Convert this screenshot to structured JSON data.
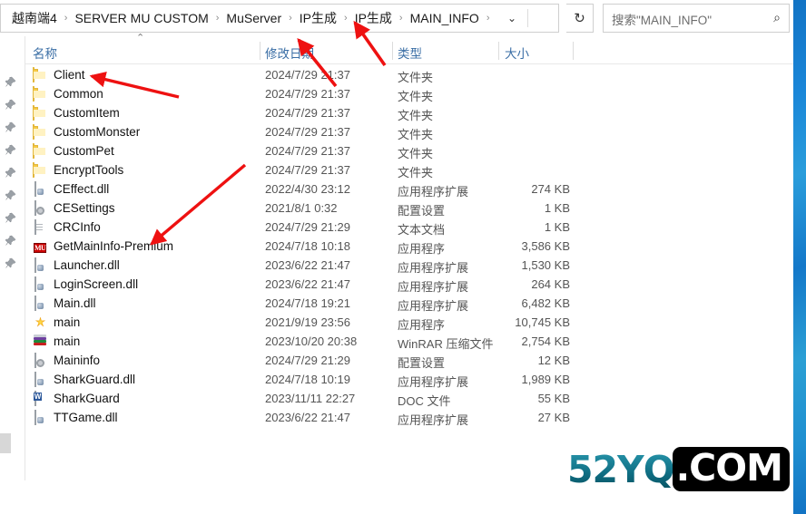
{
  "window": {
    "kind": "windows-file-explorer",
    "accent_blue": "#3a6ea5",
    "folder_yellow": "#ffd966",
    "annotation_red": "#ee1111"
  },
  "addressbar": {
    "crumbs": [
      {
        "label": "越南端4"
      },
      {
        "label": "SERVER MU CUSTOM"
      },
      {
        "label": "MuServer"
      },
      {
        "label": "IP生成"
      },
      {
        "label": "IP生成"
      },
      {
        "label": "MAIN_INFO"
      }
    ],
    "separator": "›",
    "history_dropdown_icon": "⌄",
    "refresh_icon": "↻"
  },
  "search": {
    "placeholder": "搜索\"MAIN_INFO\"",
    "icon": "⌕"
  },
  "columns": {
    "name": "名称",
    "date_modified": "修改日期",
    "type": "类型",
    "size": "大小",
    "sort_caret": "⌃",
    "sorted_by": "名称",
    "sort_direction": "ascending"
  },
  "rows": [
    {
      "icon": "folder",
      "name": "Client",
      "date": "2024/7/29 21:37",
      "type": "文件夹",
      "size": ""
    },
    {
      "icon": "folder",
      "name": "Common",
      "date": "2024/7/29 21:37",
      "type": "文件夹",
      "size": ""
    },
    {
      "icon": "folder",
      "name": "CustomItem",
      "date": "2024/7/29 21:37",
      "type": "文件夹",
      "size": ""
    },
    {
      "icon": "folder",
      "name": "CustomMonster",
      "date": "2024/7/29 21:37",
      "type": "文件夹",
      "size": ""
    },
    {
      "icon": "folder",
      "name": "CustomPet",
      "date": "2024/7/29 21:37",
      "type": "文件夹",
      "size": ""
    },
    {
      "icon": "folder",
      "name": "EncryptTools",
      "date": "2024/7/29 21:37",
      "type": "文件夹",
      "size": ""
    },
    {
      "icon": "dll",
      "name": "CEffect.dll",
      "date": "2022/4/30 23:12",
      "type": "应用程序扩展",
      "size": "274 KB"
    },
    {
      "icon": "cog",
      "name": "CESettings",
      "date": "2021/8/1 0:32",
      "type": "配置设置",
      "size": "1 KB"
    },
    {
      "icon": "doc",
      "name": "CRCInfo",
      "date": "2024/7/29 21:29",
      "type": "文本文档",
      "size": "1 KB"
    },
    {
      "icon": "mu",
      "name": "GetMainInfo-Premium",
      "date": "2024/7/18 10:18",
      "type": "应用程序",
      "size": "3,586 KB"
    },
    {
      "icon": "dll",
      "name": "Launcher.dll",
      "date": "2023/6/22 21:47",
      "type": "应用程序扩展",
      "size": "1,530 KB"
    },
    {
      "icon": "dll",
      "name": "LoginScreen.dll",
      "date": "2023/6/22 21:47",
      "type": "应用程序扩展",
      "size": "264 KB"
    },
    {
      "icon": "dll",
      "name": "Main.dll",
      "date": "2024/7/18 19:21",
      "type": "应用程序扩展",
      "size": "6,482 KB"
    },
    {
      "icon": "exe",
      "name": "main",
      "date": "2021/9/19 23:56",
      "type": "应用程序",
      "size": "10,745 KB"
    },
    {
      "icon": "rar",
      "name": "main",
      "date": "2023/10/20 20:38",
      "type": "WinRAR 压缩文件",
      "size": "2,754 KB"
    },
    {
      "icon": "cog",
      "name": "Maininfo",
      "date": "2024/7/29 21:29",
      "type": "配置设置",
      "size": "12 KB"
    },
    {
      "icon": "dll",
      "name": "SharkGuard.dll",
      "date": "2024/7/18 10:19",
      "type": "应用程序扩展",
      "size": "1,989 KB"
    },
    {
      "icon": "word",
      "name": "SharkGuard",
      "date": "2023/11/11 22:27",
      "type": "DOC 文件",
      "size": "55 KB"
    },
    {
      "icon": "dll",
      "name": "TTGame.dll",
      "date": "2023/6/22 21:47",
      "type": "应用程序扩展",
      "size": "27 KB"
    }
  ],
  "annotations": [
    {
      "name": "arrow-to-client-folder",
      "points_at": "Client"
    },
    {
      "name": "arrow-to-breadcrumb-ip-1",
      "points_at": "IP生成"
    },
    {
      "name": "arrow-to-breadcrumb-ip-2",
      "points_at": "IP生成"
    },
    {
      "name": "arrow-to-getmaininfo-premium",
      "points_at": "GetMainInfo-Premium"
    }
  ],
  "watermark": {
    "primary": "52YQ",
    "secondary": ".COM",
    "primary_color": "#0f6d82",
    "secondary_bg": "#000000"
  }
}
